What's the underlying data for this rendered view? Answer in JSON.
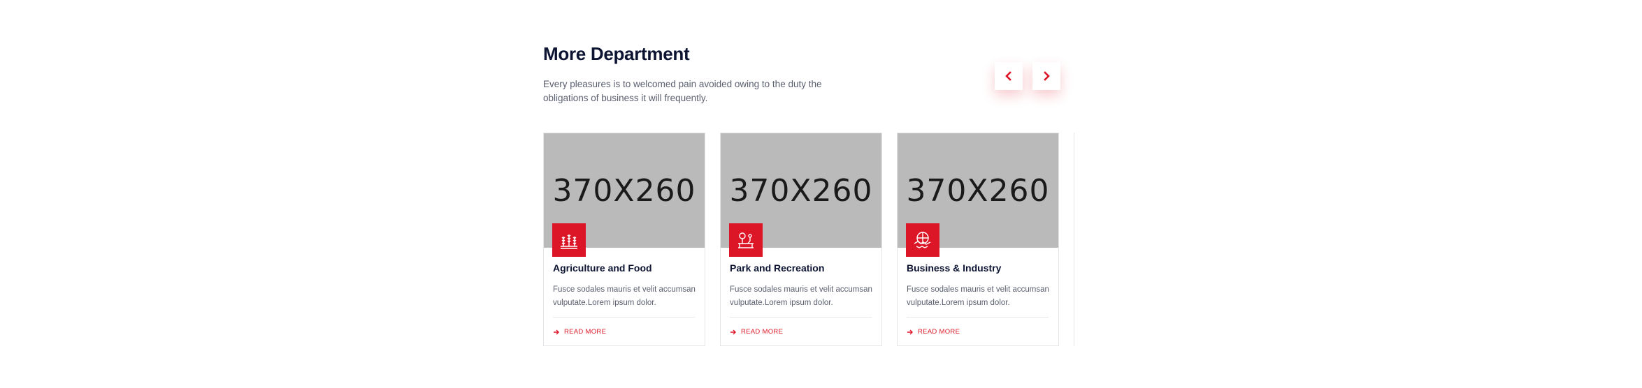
{
  "section": {
    "title": "More Department",
    "subtitle": "Every pleasures is to welcomed pain avoided owing to the duty the obligations of business it will frequently."
  },
  "nav": {
    "prev_icon": "chevron-left-icon",
    "next_icon": "chevron-right-icon"
  },
  "cards": [
    {
      "image_text": "370X260",
      "icon": "wheat-field-icon",
      "title": "Agriculture and Food",
      "text": "Fusce sodales mauris et velit accumsan vulputate.Lorem ipsum dolor.",
      "link": "READ MORE"
    },
    {
      "image_text": "370X260",
      "icon": "park-bench-icon",
      "title": "Park and Recreation",
      "text": "Fusce sodales mauris et velit accumsan vulputate.Lorem ipsum dolor.",
      "link": "READ MORE"
    },
    {
      "image_text": "370X260",
      "icon": "handshake-icon",
      "title": "Business & Industry",
      "text": "Fusce sodales mauris et velit accumsan vulputate.Lorem ipsum dolor.",
      "link": "READ MORE"
    }
  ],
  "colors": {
    "accent": "#dd1627",
    "heading": "#0c1432",
    "image_placeholder": "#bababa"
  }
}
